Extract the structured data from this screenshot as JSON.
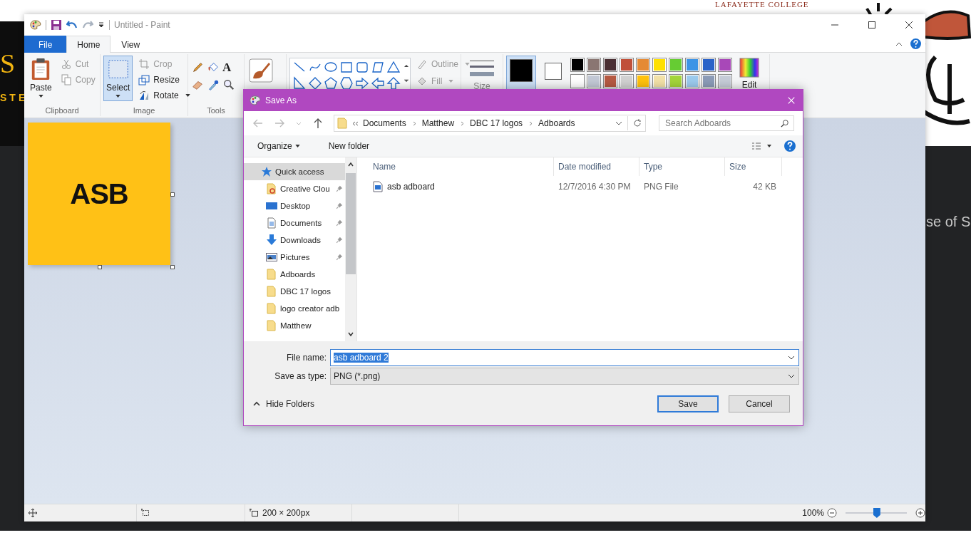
{
  "backdrop": {
    "college_name": "LAFAYETTE COLLEGE",
    "logo_text": "S",
    "tagline": "STE",
    "side_text": "se of S"
  },
  "window": {
    "title": "Untitled - Paint"
  },
  "ribbon_tabs": [
    {
      "label": "File",
      "kind": "file",
      "selected": false
    },
    {
      "label": "Home",
      "kind": "tab",
      "selected": true
    },
    {
      "label": "View",
      "kind": "tab",
      "selected": false
    }
  ],
  "clipboard": {
    "label": "Clipboard",
    "paste": "Paste",
    "actions": [
      {
        "label": "Cut",
        "kind": "cut",
        "disabled": true
      },
      {
        "label": "Copy",
        "kind": "copy",
        "disabled": true
      }
    ]
  },
  "image": {
    "label": "Image",
    "select": {
      "label": "Select",
      "selected": true
    },
    "actions": [
      {
        "label": "Crop",
        "kind": "crop",
        "disabled": true,
        "menu": false
      },
      {
        "label": "Resize",
        "kind": "resize",
        "disabled": false,
        "menu": false
      },
      {
        "label": "Rotate",
        "kind": "rotate",
        "disabled": false,
        "menu": true
      }
    ]
  },
  "tools": {
    "label": "Tools",
    "text_glyph": "A"
  },
  "outline": {
    "label": "Outline",
    "disabled": true
  },
  "fill": {
    "label": "Fill",
    "disabled": true
  },
  "size": {
    "label": "Size"
  },
  "colors": {
    "color_1": {
      "color": "#000000",
      "selected": true
    },
    "color_2": {
      "color": "#ffffff",
      "selected": false
    },
    "palette": [
      {
        "color": "#000000"
      },
      {
        "color": "#8a7672"
      },
      {
        "color": "#4a2f33"
      },
      {
        "color": "#c0503a"
      },
      {
        "color": "#e58a35"
      },
      {
        "color": "#ffe000"
      },
      {
        "color": "#66cc33"
      },
      {
        "color": "#3d94e6"
      },
      {
        "color": "#2a62c8"
      },
      {
        "color": "#a848b8"
      },
      {
        "color": "#ffffff"
      },
      {
        "color": "#c3c9d6"
      },
      {
        "color": "#b65a42"
      },
      {
        "color": "#d2d2d2"
      },
      {
        "color": "#ffc20e"
      },
      {
        "color": "#f3e2a8"
      },
      {
        "color": "#a4d63a"
      },
      {
        "color": "#9ccbee"
      },
      {
        "color": "#8c9cb8"
      },
      {
        "color": "#c6ccd8"
      }
    ],
    "edit": {
      "label": "Edit"
    }
  },
  "canvas": {
    "text": "ASB"
  },
  "status_bar": {
    "dimensions": "200 × 200px",
    "zoom": "100%",
    "zoom_slider": {
      "level": 0.51
    }
  },
  "dialog": {
    "title": "Save As",
    "path": [
      "Documents",
      "Matthew",
      "DBC 17 logos",
      "Adboards"
    ],
    "search_placeholder": "Search Adboards",
    "organize": "Organize",
    "new_folder": "New folder",
    "nav_items": [
      {
        "label": "Quick access",
        "kind": "star",
        "pinned": false,
        "selected": true
      },
      {
        "label": "Creative Clou",
        "kind": "cloud",
        "pinned": true,
        "selected": false
      },
      {
        "label": "Desktop",
        "kind": "desktop",
        "pinned": true,
        "selected": false
      },
      {
        "label": "Documents",
        "kind": "documents",
        "pinned": true,
        "selected": false
      },
      {
        "label": "Downloads",
        "kind": "downloads",
        "pinned": true,
        "selected": false
      },
      {
        "label": "Pictures",
        "kind": "pictures",
        "pinned": true,
        "selected": false
      },
      {
        "label": "Adboards",
        "kind": "folder",
        "pinned": false,
        "selected": false
      },
      {
        "label": "DBC 17 logos",
        "kind": "folder",
        "pinned": false,
        "selected": false
      },
      {
        "label": "logo creator adb",
        "kind": "folder",
        "pinned": false,
        "selected": false
      },
      {
        "label": "Matthew",
        "kind": "folder",
        "pinned": false,
        "selected": false
      }
    ],
    "columns": [
      "Name",
      "Date modified",
      "Type",
      "Size"
    ],
    "files": [
      {
        "name": "asb adboard",
        "date": "12/7/2016 4:30 PM",
        "type": "PNG File",
        "size": "42 KB"
      }
    ],
    "file_name_label": "File name:",
    "file_name": "asb adboard 2",
    "type_label": "Save as type:",
    "type_value": "PNG (*.png)",
    "hide_folders": "Hide Folders",
    "buttons": [
      {
        "label": "Save",
        "default": true
      },
      {
        "label": "Cancel",
        "default": false
      }
    ]
  }
}
